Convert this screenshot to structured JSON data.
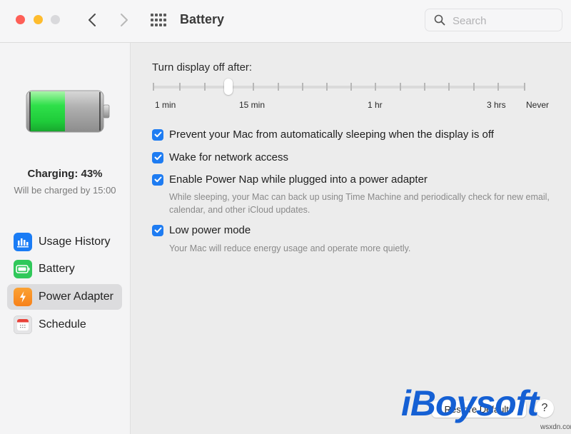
{
  "window": {
    "title": "Battery",
    "search_placeholder": "Search",
    "search_value": ""
  },
  "sidebar": {
    "battery_level_percent": 43,
    "charge_status": "Charging: 43%",
    "charge_eta": "Will be charged by 15:00",
    "items": [
      {
        "label": "Usage History",
        "icon": "bar-chart-icon",
        "color": "#1a7cf5",
        "selected": false
      },
      {
        "label": "Battery",
        "icon": "battery-icon",
        "color": "#30c85a",
        "selected": false
      },
      {
        "label": "Power Adapter",
        "icon": "lightning-bolt-icon",
        "color": "#fb8f1e",
        "selected": true
      },
      {
        "label": "Schedule",
        "icon": "calendar-icon",
        "color": "#e8e8e8",
        "selected": false
      }
    ]
  },
  "main": {
    "slider": {
      "label": "Turn display off after:",
      "value": "10 min",
      "tick_labels": [
        "1 min",
        "15 min",
        "1 hr",
        "3 hrs",
        "Never"
      ]
    },
    "options": [
      {
        "label": "Prevent your Mac from automatically sleeping when the display is off",
        "checked": true,
        "description": ""
      },
      {
        "label": "Wake for network access",
        "checked": true,
        "description": ""
      },
      {
        "label": "Enable Power Nap while plugged into a power adapter",
        "checked": true,
        "description": "While sleeping, your Mac can back up using Time Machine and periodically check for new email, calendar, and other iCloud updates."
      },
      {
        "label": "Low power mode",
        "checked": true,
        "description": "Your Mac will reduce energy usage and operate more quietly."
      }
    ],
    "restore_defaults_label": "Restore Defaults",
    "help_label": "?"
  },
  "colors": {
    "accent": "#1e7cf2",
    "close": "#fe5f57",
    "minimize": "#febc2e",
    "zoom": "#d9d9dc",
    "battery_fill": "#2fd84a"
  },
  "watermark": {
    "brand": "iBoysoft",
    "site": "wsxdn.com"
  }
}
